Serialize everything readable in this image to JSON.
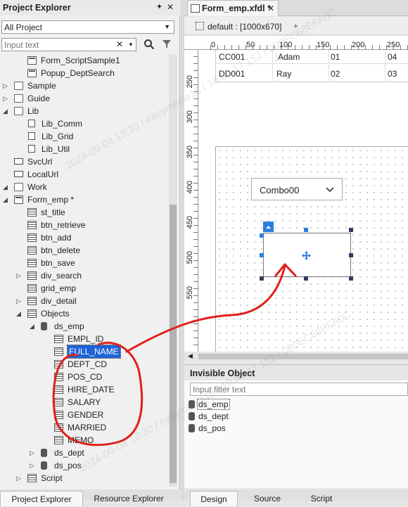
{
  "explorer": {
    "title": "Project Explorer",
    "pin_glyph": "✦",
    "close_glyph": "✕",
    "scope": "All Project",
    "search_placeholder": "Input text",
    "tree": [
      {
        "label": "Form_ScriptSample1",
        "depth": 2,
        "icon": "form"
      },
      {
        "label": "Popup_DeptSearch",
        "depth": 2,
        "icon": "form"
      },
      {
        "label": "Sample",
        "depth": 0,
        "icon": "folder",
        "twisty": "▷"
      },
      {
        "label": "Guide",
        "depth": 0,
        "icon": "folder",
        "twisty": "▷"
      },
      {
        "label": "Lib",
        "depth": 0,
        "icon": "folder",
        "twisty": "◢"
      },
      {
        "label": "Lib_Comm",
        "depth": 1,
        "icon": "lib"
      },
      {
        "label": "Lib_Grid",
        "depth": 1,
        "icon": "lib"
      },
      {
        "label": "Lib_Util",
        "depth": 1,
        "icon": "lib"
      },
      {
        "label": "SvcUrl",
        "depth": 0,
        "icon": "url"
      },
      {
        "label": "LocalUrl",
        "depth": 0,
        "icon": "url"
      },
      {
        "label": "Work",
        "depth": 0,
        "icon": "folder",
        "twisty": "◢"
      },
      {
        "label": "Form_emp *",
        "depth": 1,
        "icon": "form",
        "twisty": "◢"
      },
      {
        "label": "st_title",
        "depth": 2,
        "icon": "grid"
      },
      {
        "label": "btn_retrieve",
        "depth": 2,
        "icon": "grid"
      },
      {
        "label": "btn_add",
        "depth": 2,
        "icon": "grid"
      },
      {
        "label": "btn_delete",
        "depth": 2,
        "icon": "grid"
      },
      {
        "label": "btn_save",
        "depth": 2,
        "icon": "grid"
      },
      {
        "label": "div_search",
        "depth": 2,
        "icon": "grid",
        "twisty": "▷"
      },
      {
        "label": "grid_emp",
        "depth": 2,
        "icon": "grid"
      },
      {
        "label": "div_detail",
        "depth": 2,
        "icon": "grid",
        "twisty": "▷"
      },
      {
        "label": "Objects",
        "depth": 2,
        "icon": "grid",
        "twisty": "◢"
      },
      {
        "label": "ds_emp",
        "depth": 3,
        "icon": "db",
        "twisty": "◢"
      },
      {
        "label": "EMPL_ID",
        "depth": 4,
        "icon": "grid"
      },
      {
        "label": "FULL_NAME",
        "depth": 4,
        "icon": "grid",
        "selected": true
      },
      {
        "label": "DEPT_CD",
        "depth": 4,
        "icon": "grid"
      },
      {
        "label": "POS_CD",
        "depth": 4,
        "icon": "grid"
      },
      {
        "label": "HIRE_DATE",
        "depth": 4,
        "icon": "grid"
      },
      {
        "label": "SALARY",
        "depth": 4,
        "icon": "grid"
      },
      {
        "label": "GENDER",
        "depth": 4,
        "icon": "grid"
      },
      {
        "label": "MARRIED",
        "depth": 4,
        "icon": "grid"
      },
      {
        "label": "MEMO",
        "depth": 4,
        "icon": "grid"
      },
      {
        "label": "ds_dept",
        "depth": 3,
        "icon": "db",
        "twisty": "▷"
      },
      {
        "label": "ds_pos",
        "depth": 3,
        "icon": "db",
        "twisty": "▷"
      },
      {
        "label": "Script",
        "depth": 2,
        "icon": "grid",
        "twisty": "▷"
      }
    ],
    "bottom_tabs": [
      "Project Explorer",
      "Resource Explorer"
    ]
  },
  "editor": {
    "tab_title": "Form_emp.xfdl *",
    "tab_close": "✕",
    "layout": "default :  [1000x670]",
    "add_glyph": "+",
    "ruler_top": [
      "0",
      "50",
      "100",
      "150",
      "200",
      "250"
    ],
    "ruler_left": [
      "250",
      "300",
      "350",
      "400",
      "450",
      "500",
      "550"
    ],
    "grid_rows": [
      [
        "CC001",
        "Adam",
        "01",
        "04"
      ],
      [
        "DD001",
        "Ray",
        "02",
        "03"
      ]
    ],
    "combo_text": "Combo00",
    "bottom_tabs": [
      "Design",
      "Source",
      "Script"
    ]
  },
  "invisible": {
    "title": "Invisible Object",
    "filter_placeholder": "Input filter text",
    "items": [
      "ds_emp",
      "ds_dept",
      "ds_pos"
    ]
  },
  "watermarks": [
    "2024-09-04 13:30 / easymedia18 / 10.86.17.152 / 000EC68EFA0C"
  ],
  "annotation_color": "#e0201a"
}
